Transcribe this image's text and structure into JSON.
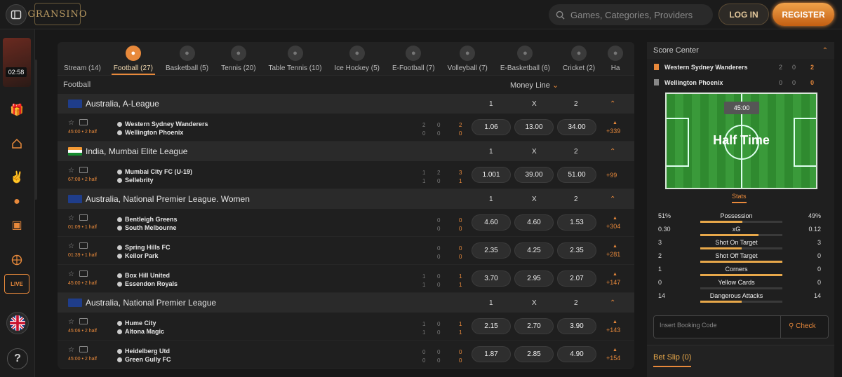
{
  "header": {
    "logo_text": "GRANSINO",
    "search_placeholder": "Games, Categories, Providers",
    "login_label": "LOG IN",
    "register_label": "REGISTER"
  },
  "sidebar": {
    "live_timer": "02:58",
    "live_label": "LIVE",
    "help_label": "?"
  },
  "sports_tabs": [
    {
      "label": "Stream (14)",
      "icon": "stream-icon"
    },
    {
      "label": "Football (27)",
      "icon": "football-icon"
    },
    {
      "label": "Basketball (5)",
      "icon": "basketball-icon"
    },
    {
      "label": "Tennis (20)",
      "icon": "tennis-icon"
    },
    {
      "label": "Table Tennis (10)",
      "icon": "table-tennis-icon"
    },
    {
      "label": "Ice Hockey (5)",
      "icon": "ice-hockey-icon"
    },
    {
      "label": "E-Football (7)",
      "icon": "efootball-icon"
    },
    {
      "label": "Volleyball (7)",
      "icon": "volleyball-icon"
    },
    {
      "label": "E-Basketball (6)",
      "icon": "ebasketball-icon"
    },
    {
      "label": "Cricket (2)",
      "icon": "cricket-icon"
    },
    {
      "label": "Ha",
      "icon": "handball-icon"
    }
  ],
  "section_title": "Football",
  "market_label": "Money Line",
  "col_headers": {
    "one": "1",
    "x": "X",
    "two": "2"
  },
  "leagues": [
    {
      "name": "Australia, A-League",
      "flag": "australia",
      "matches": [
        {
          "time": "45:00 • 2 half",
          "team1": "Western Sydney Wanderers",
          "team2": "Wellington Phoenix",
          "s1": [
            "2",
            "0",
            "2"
          ],
          "s2": [
            "0",
            "0",
            "0"
          ],
          "odds": [
            "1.06",
            "13.00",
            "34.00"
          ],
          "more": "+339"
        }
      ]
    },
    {
      "name": "India, Mumbai Elite League",
      "flag": "india",
      "matches": [
        {
          "time": "67:08 • 2 half",
          "team1": "Mumbai City FC (U-19)",
          "team2": "Sellebrity",
          "s1": [
            "1",
            "2",
            "3"
          ],
          "s2": [
            "1",
            "0",
            "1"
          ],
          "odds": [
            "1.001",
            "39.00",
            "51.00"
          ],
          "more": "+99"
        }
      ]
    },
    {
      "name": "Australia, National Premier League. Women",
      "flag": "australia",
      "matches": [
        {
          "time": "01:09 • 1 half",
          "team1": "Bentleigh Greens",
          "team2": "South Melbourne",
          "s1": [
            "0",
            "0"
          ],
          "s2": [
            "0",
            "0"
          ],
          "odds": [
            "4.60",
            "4.60",
            "1.53"
          ],
          "more": "+304"
        },
        {
          "time": "01:39 • 1 half",
          "team1": "Spring Hills FC",
          "team2": "Keilor Park",
          "s1": [
            "0",
            "0"
          ],
          "s2": [
            "0",
            "0"
          ],
          "odds": [
            "2.35",
            "4.25",
            "2.35"
          ],
          "more": "+281"
        },
        {
          "time": "45:00 • 2 half",
          "team1": "Box Hill United",
          "team2": "Essendon Royals",
          "s1": [
            "1",
            "0",
            "1"
          ],
          "s2": [
            "1",
            "0",
            "1"
          ],
          "odds": [
            "3.70",
            "2.95",
            "2.07"
          ],
          "more": "+147"
        }
      ]
    },
    {
      "name": "Australia, National Premier League",
      "flag": "australia",
      "matches": [
        {
          "time": "45:06 • 2 half",
          "team1": "Hume City",
          "team2": "Altona Magic",
          "s1": [
            "1",
            "0",
            "1"
          ],
          "s2": [
            "1",
            "0",
            "1"
          ],
          "odds": [
            "2.15",
            "2.70",
            "3.90"
          ],
          "more": "+143"
        },
        {
          "time": "45:00 • 2 half",
          "team1": "Heidelberg Utd",
          "team2": "Green Gully FC",
          "s1": [
            "0",
            "0",
            "0"
          ],
          "s2": [
            "0",
            "0",
            "0"
          ],
          "odds": [
            "1.87",
            "2.85",
            "4.90"
          ],
          "more": "+154"
        }
      ]
    }
  ],
  "score_center": {
    "title": "Score Center",
    "team1": "Western Sydney Wanderers",
    "team2": "Wellington Phoenix",
    "t1_scores": [
      "2",
      "0",
      "2"
    ],
    "t2_scores": [
      "0",
      "0",
      "0"
    ],
    "clock": "45:00",
    "status": "Half Time",
    "stats_tab": "Stats",
    "stats": [
      {
        "name": "Possession",
        "left": "51%",
        "right": "49%",
        "ratio": 0.51
      },
      {
        "name": "xG",
        "left": "0.30",
        "right": "0.12",
        "ratio": 0.71
      },
      {
        "name": "Shot On Target",
        "left": "3",
        "right": "3",
        "ratio": 0.5
      },
      {
        "name": "Shot Off Target",
        "left": "2",
        "right": "0",
        "ratio": 1.0
      },
      {
        "name": "Corners",
        "left": "1",
        "right": "0",
        "ratio": 1.0
      },
      {
        "name": "Yellow Cards",
        "left": "0",
        "right": "0",
        "ratio": 0.0
      },
      {
        "name": "Dangerous Attacks",
        "left": "14",
        "right": "14",
        "ratio": 0.5
      }
    ]
  },
  "booking": {
    "placeholder": "Insert Booking Code",
    "check_label": "Check"
  },
  "betslip_label": "Bet Slip (0)",
  "colors": {
    "accent": "#e8893b",
    "bg": "#181818",
    "pitch": "#2f8a2f"
  }
}
